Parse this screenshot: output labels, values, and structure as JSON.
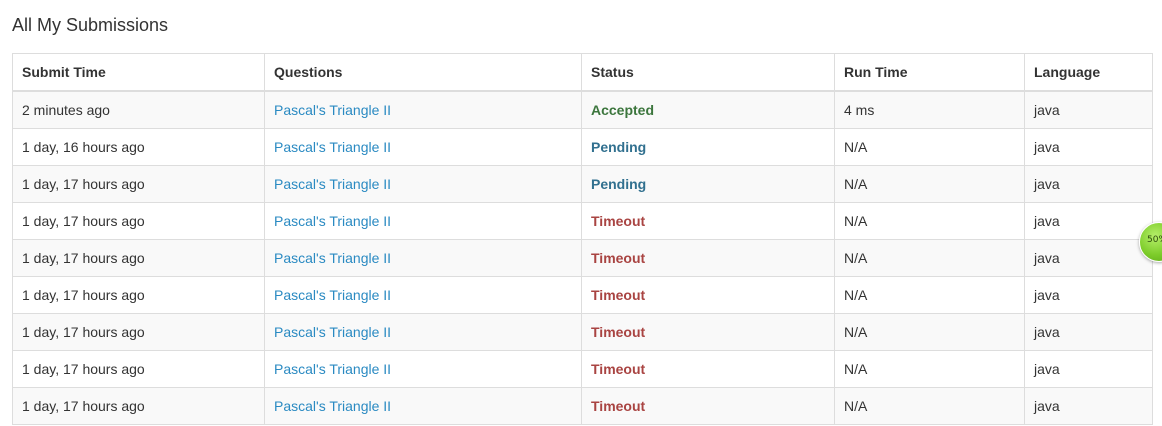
{
  "page": {
    "title": "All My Submissions"
  },
  "table": {
    "headers": {
      "submit_time": "Submit Time",
      "questions": "Questions",
      "status": "Status",
      "run_time": "Run Time",
      "language": "Language"
    },
    "rows": [
      {
        "submit_time": "2 minutes ago",
        "question": "Pascal's Triangle II",
        "status": "Accepted",
        "run_time": "4 ms",
        "language": "java"
      },
      {
        "submit_time": "1 day, 16 hours ago",
        "question": "Pascal's Triangle II",
        "status": "Pending",
        "run_time": "N/A",
        "language": "java"
      },
      {
        "submit_time": "1 day, 17 hours ago",
        "question": "Pascal's Triangle II",
        "status": "Pending",
        "run_time": "N/A",
        "language": "java"
      },
      {
        "submit_time": "1 day, 17 hours ago",
        "question": "Pascal's Triangle II",
        "status": "Timeout",
        "run_time": "N/A",
        "language": "java"
      },
      {
        "submit_time": "1 day, 17 hours ago",
        "question": "Pascal's Triangle II",
        "status": "Timeout",
        "run_time": "N/A",
        "language": "java"
      },
      {
        "submit_time": "1 day, 17 hours ago",
        "question": "Pascal's Triangle II",
        "status": "Timeout",
        "run_time": "N/A",
        "language": "java"
      },
      {
        "submit_time": "1 day, 17 hours ago",
        "question": "Pascal's Triangle II",
        "status": "Timeout",
        "run_time": "N/A",
        "language": "java"
      },
      {
        "submit_time": "1 day, 17 hours ago",
        "question": "Pascal's Triangle II",
        "status": "Timeout",
        "run_time": "N/A",
        "language": "java"
      },
      {
        "submit_time": "1 day, 17 hours ago",
        "question": "Pascal's Triangle II",
        "status": "Timeout",
        "run_time": "N/A",
        "language": "java"
      }
    ]
  },
  "colors": {
    "link": "#2a8ac2",
    "accepted": "#3c763d",
    "pending": "#31708f",
    "timeout": "#a94442",
    "row_stripe": "#f9f9f9",
    "border": "#dddddd"
  },
  "widget": {
    "progress_label": "50%",
    "progress_value": 0.5,
    "icon": "progress-circle-icon"
  }
}
